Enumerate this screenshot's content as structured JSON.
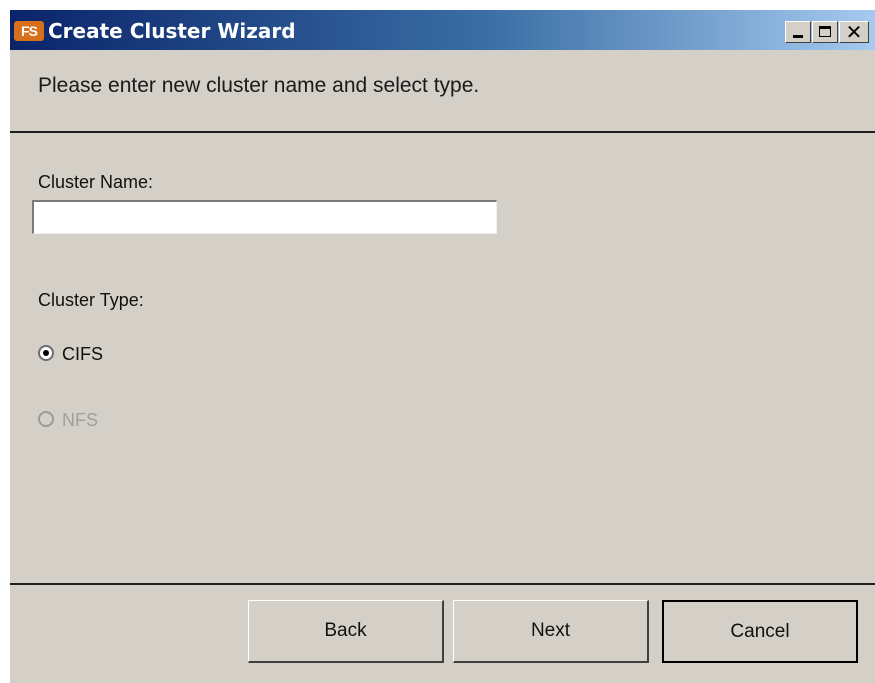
{
  "window": {
    "app_icon_text": "FS",
    "title": "Create Cluster Wizard",
    "minimize_icon": "minimize-icon",
    "maximize_icon": "maximize-icon",
    "close_icon": "close-icon",
    "close_glyph": "✕"
  },
  "header": {
    "instruction": "Please enter new cluster name and select type."
  },
  "form": {
    "cluster_name_label": "Cluster Name:",
    "cluster_name_value": "",
    "cluster_type_label": "Cluster Type:",
    "options": [
      {
        "label": "CIFS",
        "selected": true,
        "enabled": true
      },
      {
        "label": "NFS",
        "selected": false,
        "enabled": false
      }
    ]
  },
  "buttons": {
    "back": "Back",
    "next": "Next",
    "cancel": "Cancel"
  },
  "colors": {
    "face": "#d4d0c8",
    "title_start": "#0a246a",
    "title_end": "#a6caf0",
    "disabled_text": "#a0a0a0"
  }
}
